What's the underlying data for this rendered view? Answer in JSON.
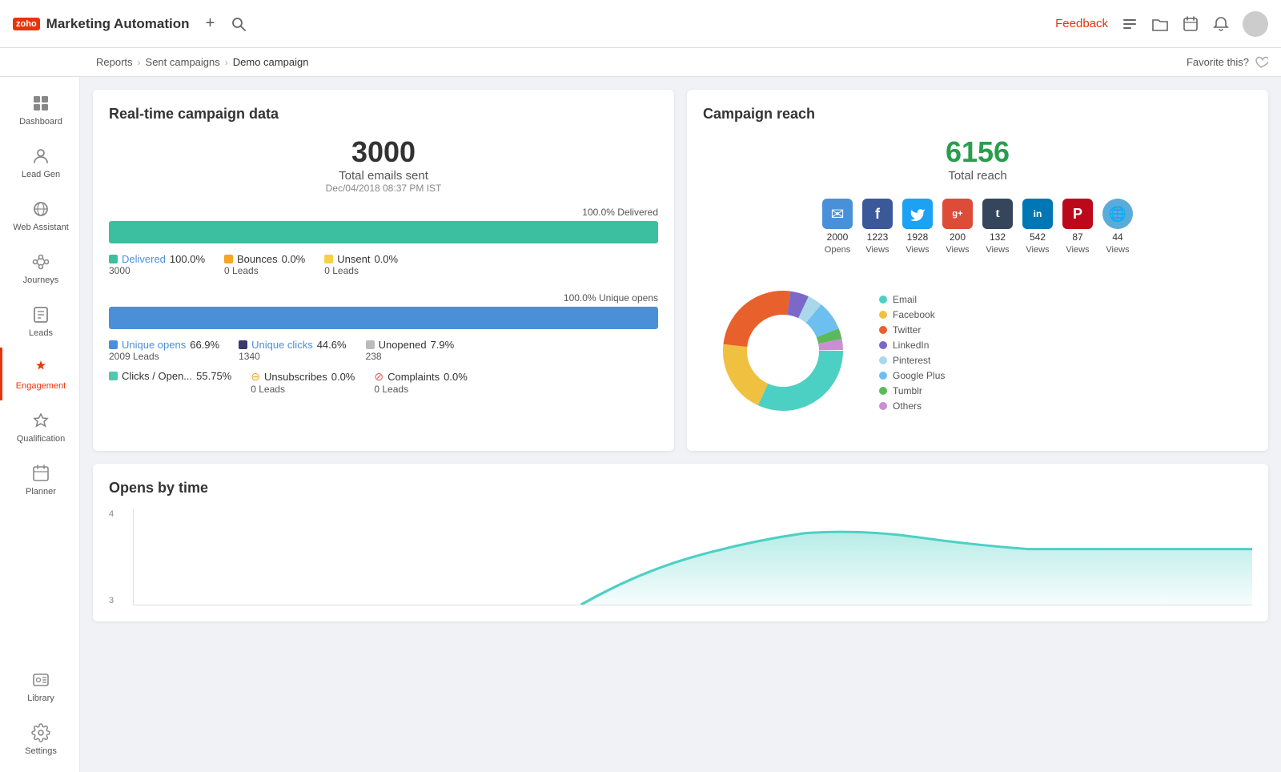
{
  "app": {
    "logo_text": "zoho",
    "title": "Marketing Automation"
  },
  "topbar": {
    "feedback_label": "Feedback",
    "favorite_label": "Favorite this?"
  },
  "breadcrumb": {
    "items": [
      {
        "label": "Reports",
        "active": false
      },
      {
        "label": "Sent campaigns",
        "active": false
      },
      {
        "label": "Demo campaign",
        "active": true
      }
    ]
  },
  "sidebar": {
    "items": [
      {
        "id": "dashboard",
        "label": "Dashboard",
        "icon": "⊞",
        "active": false
      },
      {
        "id": "leadgen",
        "label": "Lead Gen",
        "icon": "👤",
        "active": false
      },
      {
        "id": "webassistant",
        "label": "Web Assistant",
        "icon": "🌐",
        "active": false
      },
      {
        "id": "journeys",
        "label": "Journeys",
        "icon": "🔀",
        "active": false
      },
      {
        "id": "leads",
        "label": "Leads",
        "icon": "📋",
        "active": false
      },
      {
        "id": "engagement",
        "label": "Engagement",
        "icon": "✦",
        "active": true
      },
      {
        "id": "qualification",
        "label": "Qualification",
        "icon": "🔧",
        "active": false
      },
      {
        "id": "planner",
        "label": "Planner",
        "icon": "📅",
        "active": false
      },
      {
        "id": "library",
        "label": "Library",
        "icon": "🖼",
        "active": false
      },
      {
        "id": "settings",
        "label": "Settings",
        "icon": "⚙",
        "active": false
      }
    ]
  },
  "campaign_data": {
    "section_title": "Real-time campaign data",
    "total_emails": "3000",
    "total_emails_label": "Total emails sent",
    "date": "Dec/04/2018 08:37 PM IST",
    "delivered_pct_label": "100.0% Delivered",
    "delivered_pct": "100.0%",
    "delivered_label": "Delivered",
    "delivered_count": "3000",
    "bounces_pct": "0.0%",
    "bounces_label": "Bounces",
    "bounces_leads": "0 Leads",
    "unsent_pct": "0.0%",
    "unsent_label": "Unsent",
    "unsent_leads": "0 Leads",
    "unique_opens_pct_label": "100.0% Unique opens",
    "unique_opens_pct": "66.9%",
    "unique_opens_label": "Unique opens",
    "unique_opens_leads": "2009 Leads",
    "unique_clicks_pct": "44.6%",
    "unique_clicks_label": "Unique clicks",
    "unique_clicks_leads": "1340",
    "unopened_pct": "7.9%",
    "unopened_label": "Unopened",
    "unopened_count": "238",
    "clicks_opens_pct": "55.75%",
    "clicks_opens_label": "Clicks / Open...",
    "unsubscribes_pct": "0.0%",
    "unsubscribes_label": "Unsubscribes",
    "unsubscribes_leads": "0 Leads",
    "complaints_pct": "0.0%",
    "complaints_label": "Complaints",
    "complaints_leads": "0 Leads"
  },
  "campaign_reach": {
    "section_title": "Campaign reach",
    "total_reach": "6156",
    "total_reach_label": "Total reach",
    "social": [
      {
        "id": "email",
        "label": "Opens",
        "count": "2000",
        "icon": "✉",
        "color": "#4a90d9"
      },
      {
        "id": "facebook",
        "label": "Views",
        "count": "1223",
        "icon": "f",
        "color": "#3b5998"
      },
      {
        "id": "twitter",
        "label": "Views",
        "count": "1928",
        "icon": "🐦",
        "color": "#1da1f2"
      },
      {
        "id": "googleplus",
        "label": "Views",
        "count": "200",
        "icon": "g+",
        "color": "#dd4b39"
      },
      {
        "id": "tumblr",
        "label": "Views",
        "count": "132",
        "icon": "t",
        "color": "#35465c"
      },
      {
        "id": "linkedin",
        "label": "Views",
        "count": "542",
        "icon": "in",
        "color": "#0077b5"
      },
      {
        "id": "pinterest",
        "label": "Views",
        "count": "87",
        "icon": "P",
        "color": "#bd081c"
      },
      {
        "id": "web",
        "label": "Views",
        "count": "44",
        "icon": "🌐",
        "color": "#4a90d9"
      }
    ],
    "donut": {
      "segments": [
        {
          "label": "Email",
          "color": "#4dd0c4",
          "value": 32
        },
        {
          "label": "Facebook",
          "color": "#f0c040",
          "value": 20
        },
        {
          "label": "Twitter",
          "color": "#e8602c",
          "value": 25
        },
        {
          "label": "LinkedIn",
          "color": "#7b68c8",
          "value": 5
        },
        {
          "label": "Pinterest",
          "color": "#a8d8ea",
          "value": 4
        },
        {
          "label": "Google Plus",
          "color": "#6dbfef",
          "value": 8
        },
        {
          "label": "Tumblr",
          "color": "#5cb85c",
          "value": 3
        },
        {
          "label": "Others",
          "color": "#c890d0",
          "value": 3
        }
      ]
    }
  },
  "opens_by_time": {
    "section_title": "Opens by time",
    "y_labels": [
      "4",
      "3"
    ]
  }
}
